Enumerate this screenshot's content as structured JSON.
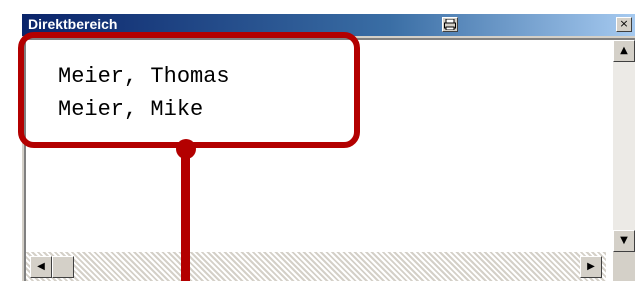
{
  "window": {
    "title": "Direktbereich",
    "print_icon": "print-icon",
    "close_label": "×"
  },
  "content": {
    "lines": [
      "Meier, Thomas",
      "Meier, Mike"
    ]
  },
  "scrollbars": {
    "up_arrow": "▲",
    "down_arrow": "▼",
    "left_arrow": "◀",
    "right_arrow": "▶"
  },
  "colors": {
    "callout": "#b30000",
    "titlebar_start": "#0a246a",
    "titlebar_end": "#a6caf0"
  }
}
